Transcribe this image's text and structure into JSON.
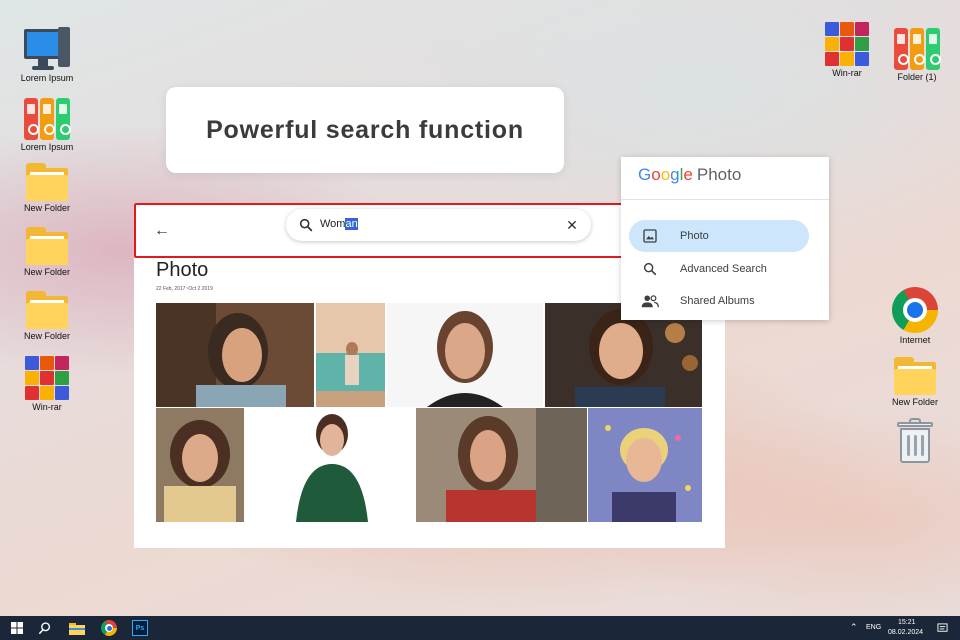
{
  "desktop": {
    "left_icons": [
      {
        "label": "Lorem Ipsum",
        "icon": "computer-icon"
      },
      {
        "label": "Lorem Ipsum",
        "icon": "binders-icon"
      },
      {
        "label": "New Folder",
        "icon": "folder-icon"
      },
      {
        "label": "New Folder",
        "icon": "folder-icon"
      },
      {
        "label": "New Folder",
        "icon": "folder-icon"
      },
      {
        "label": "Win-rar",
        "icon": "winrar-icon"
      }
    ],
    "top_right_icons": [
      {
        "label": "Win-rar",
        "icon": "winrar-icon"
      },
      {
        "label": "Folder (1)",
        "icon": "binders-icon"
      }
    ],
    "right_icons": [
      {
        "label": "Internet",
        "icon": "chrome-icon"
      },
      {
        "label": "New Folder",
        "icon": "folder-icon"
      },
      {
        "label": "",
        "icon": "recycle-bin-icon"
      }
    ]
  },
  "headline": "Powerful search function",
  "photo_app": {
    "search_typed": "Wom",
    "search_selected": "an",
    "title": "Photo",
    "date_range": "22 Feb, 2017~Oct 2 2019",
    "tile_count": 8
  },
  "gp_menu": {
    "brand_letters": [
      "G",
      "o",
      "o",
      "g",
      "l",
      "e"
    ],
    "brand_rest": "Photo",
    "items": [
      {
        "label": "Photo",
        "icon": "photo-icon",
        "active": true
      },
      {
        "label": "Advanced Search",
        "icon": "search-icon",
        "active": false
      },
      {
        "label": "Shared Albums",
        "icon": "people-icon",
        "active": false
      }
    ]
  },
  "taskbar": {
    "lang": "ENG",
    "time": "15:21",
    "date": "08.02.2024"
  },
  "colors": {
    "highlight_border": "#e01b1b",
    "menu_active": "#cde6fb",
    "taskbar": "#1b2738"
  }
}
